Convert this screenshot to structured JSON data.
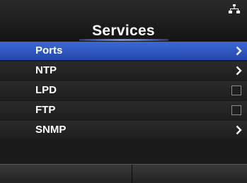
{
  "header": {
    "title": "Services",
    "status_icon": "network-icon"
  },
  "menu": {
    "items": [
      {
        "label": "Ports",
        "control": "chevron",
        "selected": true
      },
      {
        "label": "NTP",
        "control": "chevron",
        "selected": false
      },
      {
        "label": "LPD",
        "control": "checkbox",
        "checked": false,
        "selected": false
      },
      {
        "label": "FTP",
        "control": "checkbox",
        "checked": false,
        "selected": false
      },
      {
        "label": "SNMP",
        "control": "chevron",
        "selected": false
      }
    ]
  },
  "softkeys": {
    "left_label": "",
    "right_label": ""
  },
  "colors": {
    "accent": "#2f57c2",
    "background": "#1b1b1b"
  }
}
